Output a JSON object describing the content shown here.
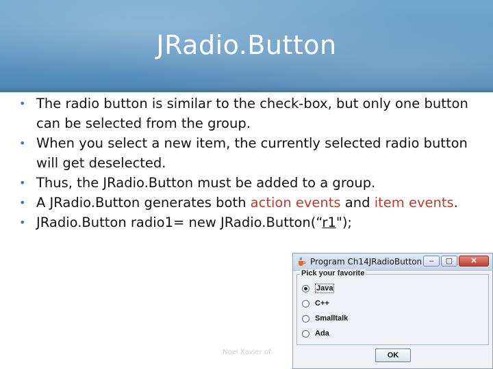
{
  "slide": {
    "title": "JRadio.Button",
    "bullets": [
      {
        "segments": [
          {
            "text": "The radio button is similar to the check-box, but only one button can be selected from the group.",
            "style": "normal"
          }
        ]
      },
      {
        "segments": [
          {
            "text": " When you select a new item, the currently selected radio button will get deselected.",
            "style": "normal"
          }
        ]
      },
      {
        "segments": [
          {
            "text": "Thus, the JRadio.Button must be added to a group.",
            "style": "normal"
          }
        ]
      },
      {
        "segments": [
          {
            "text": "A JRadio.Button generates both ",
            "style": "normal"
          },
          {
            "text": "action events",
            "style": "highlight"
          },
          {
            "text": " and ",
            "style": "normal"
          },
          {
            "text": "item events",
            "style": "highlight"
          },
          {
            "text": ".",
            "style": "normal"
          }
        ]
      },
      {
        "segments": [
          {
            "text": "JRadio.Button radio1= new JRadio.Button(“",
            "style": "normal"
          },
          {
            "text": "r1",
            "style": "underline"
          },
          {
            "text": "\");",
            "style": "normal"
          }
        ]
      }
    ],
    "bullet_glyph": "•",
    "watermark": "Noel Xavier of"
  },
  "window": {
    "title": "Program Ch14JRadioButton",
    "controls": {
      "minimize": "–",
      "maximize": "▢",
      "close": "✕"
    },
    "group_label": "Pick your favorite",
    "options": [
      {
        "label": "Java",
        "selected": true
      },
      {
        "label": "C++",
        "selected": false
      },
      {
        "label": "Smalltalk",
        "selected": false
      },
      {
        "label": "Ada",
        "selected": false
      }
    ],
    "ok_label": "OK"
  },
  "colors": {
    "title_bg": "#5f97c2",
    "highlight": "#c0392b",
    "bullet": "#3a78b6"
  }
}
